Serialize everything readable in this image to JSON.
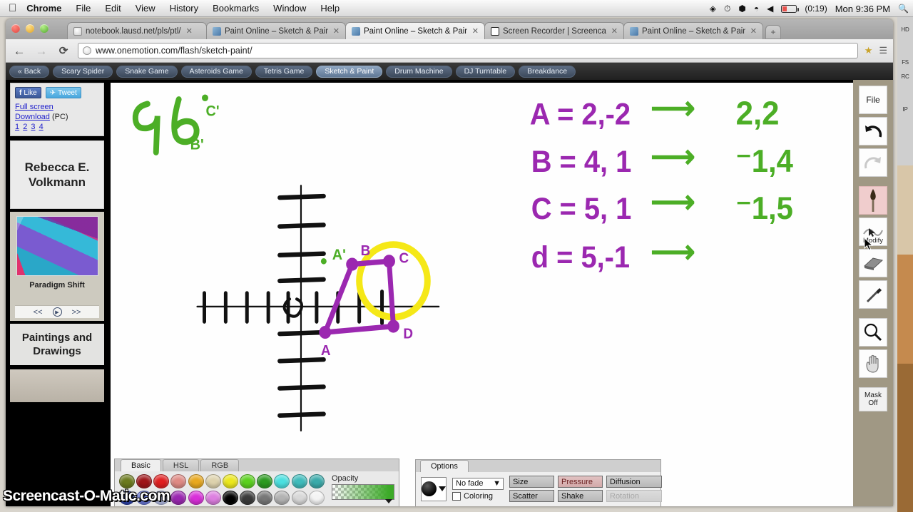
{
  "menubar": {
    "apple": "apple-logo",
    "items": [
      "Chrome",
      "File",
      "Edit",
      "View",
      "History",
      "Bookmarks",
      "Window",
      "Help"
    ],
    "battery_time": "(0:19)",
    "clock": "Mon 9:36 PM",
    "right_icons": [
      "dropbox-icon",
      "time-machine-icon",
      "bluetooth-icon",
      "wifi-icon",
      "volume-icon",
      "battery-icon",
      "spotlight-search-icon"
    ]
  },
  "browser": {
    "tabs": [
      {
        "title": "notebook.lausd.net/pls/ptl/",
        "favicon": "globe-icon",
        "active": false
      },
      {
        "title": "Paint Online – Sketch & Paint",
        "favicon": "paint-icon",
        "active": false
      },
      {
        "title": "Paint Online – Sketch & Paint",
        "favicon": "paint-icon",
        "active": true
      },
      {
        "title": "Screen Recorder | Screencast",
        "favicon": "recorder-icon",
        "active": false
      },
      {
        "title": "Paint Online – Sketch & Paint",
        "favicon": "paint-icon",
        "active": false
      }
    ],
    "new_tab_label": "+",
    "back_icon": "←",
    "forward_icon": "→",
    "reload_icon": "⟳",
    "url": "www.onemotion.com/flash/sketch-paint/",
    "bookmark_icon": "★",
    "menu_icon": "🔧",
    "close_icon": "✕"
  },
  "site_nav": {
    "buttons": [
      {
        "label": "« Back",
        "active": false
      },
      {
        "label": "Scary Spider",
        "active": false
      },
      {
        "label": "Snake Game",
        "active": false
      },
      {
        "label": "Asteroids Game",
        "active": false
      },
      {
        "label": "Tetris Game",
        "active": false
      },
      {
        "label": "Sketch & Paint",
        "active": true
      },
      {
        "label": "Drum Machine",
        "active": false
      },
      {
        "label": "DJ Turntable",
        "active": false
      },
      {
        "label": "Breakdance",
        "active": false
      }
    ]
  },
  "sidebar": {
    "like_label": "Like",
    "like_glyph": "f",
    "tweet_label": "Tweet",
    "tweet_glyph": "🐦",
    "fullscreen_label": "Full screen",
    "download_label": "Download",
    "download_suffix": "(PC)",
    "page_numbers": [
      "1",
      "2",
      "3",
      "4"
    ],
    "artist_name": "Rebecca E. Volkmann",
    "artwork_title": "Paradigm Shift",
    "nav_prev": "<<",
    "nav_play": "▶",
    "nav_next": ">>",
    "gallery_title": "Paintings and Drawings"
  },
  "tools": {
    "items": [
      {
        "name": "file-tool",
        "label": "File",
        "state": "normal"
      },
      {
        "name": "undo-tool",
        "label": "",
        "state": "normal"
      },
      {
        "name": "redo-tool",
        "label": "",
        "state": "disabled"
      },
      {
        "name": "brush-tool",
        "label": "",
        "state": "active"
      },
      {
        "name": "modify-tool",
        "label": "Modify",
        "state": "normal"
      },
      {
        "name": "eraser-tool",
        "label": "",
        "state": "normal"
      },
      {
        "name": "eyedropper-tool",
        "label": "",
        "state": "normal"
      },
      {
        "name": "zoom-tool",
        "label": "",
        "state": "normal"
      },
      {
        "name": "hand-tool",
        "label": "",
        "state": "normal"
      },
      {
        "name": "mask-tool",
        "label": "Mask Off",
        "state": "normal"
      }
    ],
    "mask_line1": "Mask",
    "mask_line2": "Off"
  },
  "palette": {
    "tabs": [
      {
        "label": "Basic",
        "active": true
      },
      {
        "label": "HSL",
        "active": false
      },
      {
        "label": "RGB",
        "active": false
      }
    ],
    "row1": [
      "#6b7a1e",
      "#9e1418",
      "#e11f20",
      "#df8a84",
      "#e8a81f",
      "#ddd2ad",
      "#ece81c",
      "#5ad11e",
      "#2c9a20",
      "#4be0e0",
      "#3fbcbc",
      "#3aaaaa"
    ],
    "row2": [
      "#2a3fa8",
      "#6a78d8",
      "#b6bfe8",
      "#9a27b0",
      "#d92fd9",
      "#dd7fe0",
      "#000000",
      "#3a3a3a",
      "#777777",
      "#b3b3b3",
      "#d8d8d8",
      "#f4f4f4"
    ],
    "opacity_label": "Opacity"
  },
  "options": {
    "tab_label": "Options",
    "fade_value": "No fade",
    "fade_caret": "▼",
    "coloring_label": "Coloring",
    "coloring_checked": false,
    "buttons": [
      {
        "label": "Size",
        "state": "normal"
      },
      {
        "label": "Pressure",
        "state": "active"
      },
      {
        "label": "Diffusion",
        "state": "normal"
      },
      {
        "label": "Scatter",
        "state": "normal"
      },
      {
        "label": "Shake",
        "state": "normal"
      },
      {
        "label": "Rotation",
        "state": "disabled"
      }
    ]
  },
  "canvas": {
    "green_number": "96",
    "notes": [
      {
        "source": "A = 2,-2",
        "arrow": "→",
        "result": "2,2"
      },
      {
        "source": "B = 4, 1",
        "arrow": "→",
        "result": "⁻1,4"
      },
      {
        "source": "C = 5, 1",
        "arrow": "→",
        "result": "⁻1,5"
      },
      {
        "source": "d = 5,-1",
        "arrow": "→",
        "result": ""
      }
    ],
    "point_labels": [
      "A",
      "B",
      "C",
      "D",
      "B'",
      "C'"
    ],
    "ink_purple": "#9b28b0",
    "ink_green": "#4cae26",
    "ink_black": "#111111",
    "ink_yellow": "#f5e817"
  },
  "watermark": "Screencast-O-Matic.com",
  "sliver_text": [
    "HD",
    "FS",
    "RC",
    "IP"
  ]
}
